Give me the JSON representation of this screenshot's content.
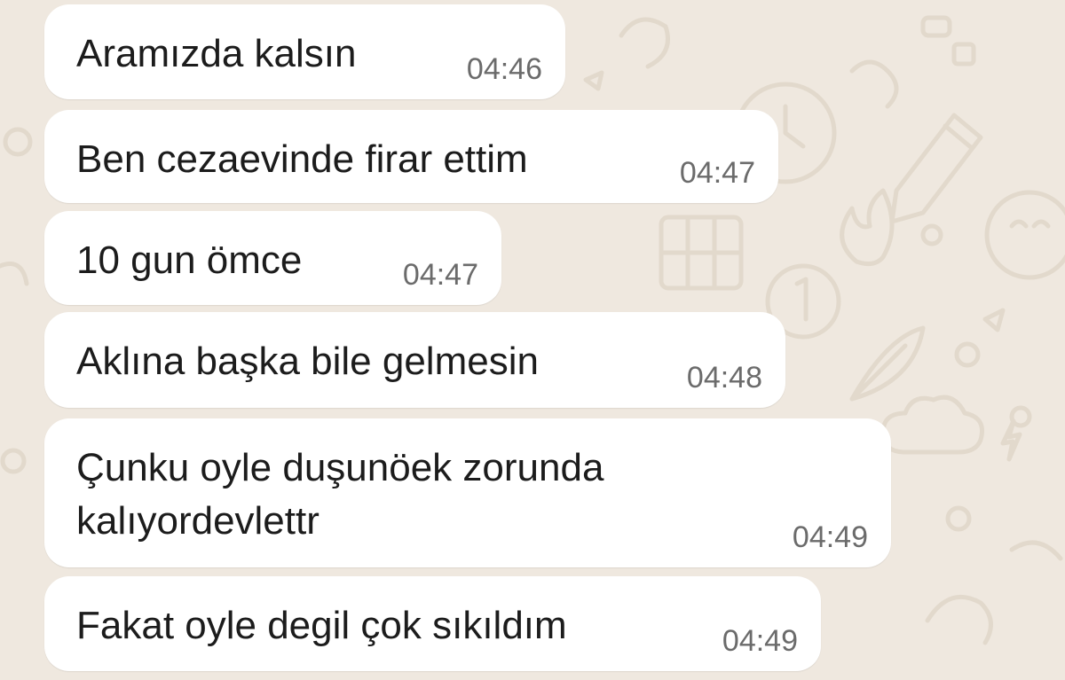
{
  "chat": {
    "messages": [
      {
        "text": "Aramızda kalsın",
        "time": "04:46"
      },
      {
        "text": "Ben cezaevinde firar ettim",
        "time": "04:47"
      },
      {
        "text": "10 gun ömce",
        "time": "04:47"
      },
      {
        "text": "Aklına başka bile gelmesin",
        "time": "04:48"
      },
      {
        "text_line1": "Çunku oyle duşunöek zorunda",
        "text_line2": "kalıyordevlettr",
        "time": "04:49"
      },
      {
        "text": "Fakat oyle degil çok sıkıldım",
        "time": "04:49"
      }
    ]
  },
  "colors": {
    "wallpaper": "#efe8df",
    "doodle": "#e2d9cc",
    "bubble": "#ffffff",
    "text": "#1c1c1c",
    "time": "#6b6b6b"
  }
}
